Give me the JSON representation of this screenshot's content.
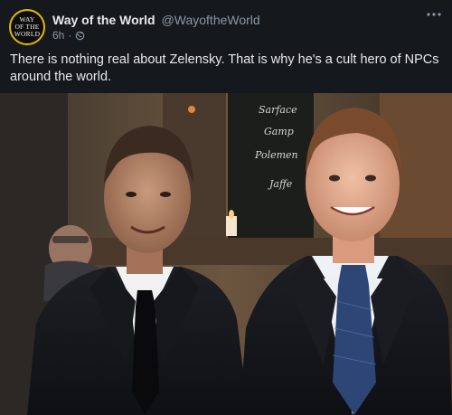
{
  "post": {
    "author": {
      "name": "Way of the World",
      "handle": "@WayoftheWorld",
      "avatar_text": [
        "WAY",
        "OF THE",
        "WORLD"
      ]
    },
    "time": "6h",
    "separator": "·",
    "visibility_icon": "globe-icon",
    "more_icon": "more-dots-icon",
    "text": "There is nothing real about Zelensky. That is why he's a cult hero of NPCs around the world.",
    "photo": {
      "subject": "photo-two-men-in-suits",
      "chalkboard_words": [
        "Sarface",
        "Gamp",
        "Polemen",
        "Jaffe"
      ]
    }
  },
  "colors": {
    "background": "#15181d",
    "text_primary": "#e7e9ea",
    "text_secondary": "#8b98a5",
    "avatar_ring": "#e5b800"
  }
}
